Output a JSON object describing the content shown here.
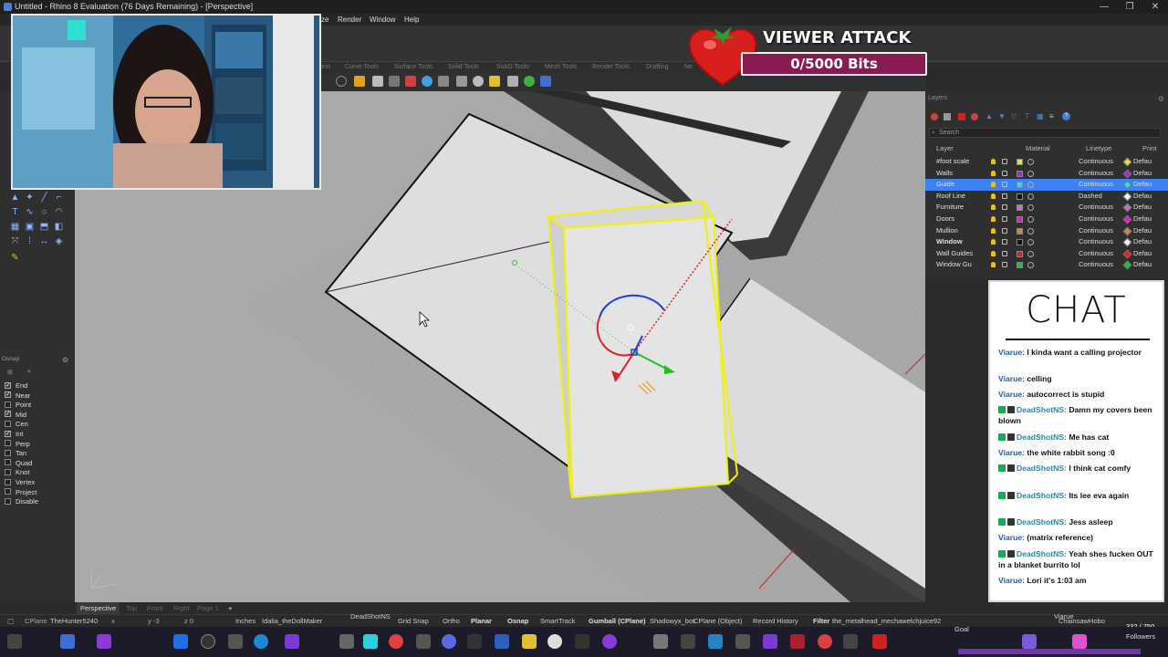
{
  "window": {
    "title": "Untitled - Rhino 8 Evaluation (76 Days Remaining) - [Perspective]",
    "controls": [
      "—",
      "❐",
      "✕"
    ]
  },
  "menu": [
    {
      "label": "ze"
    },
    {
      "label": "Render"
    },
    {
      "label": "Window"
    },
    {
      "label": "Help"
    }
  ],
  "toolbar_tabs": [
    "orm",
    "Curve Tools",
    "Surface Tools",
    "Solid Tools",
    "SubD Tools",
    "Mesh Tools",
    "Render Tools",
    "Drafting",
    "Ne"
  ],
  "osnap": {
    "title": "Osnap",
    "items": [
      {
        "label": "End",
        "checked": true
      },
      {
        "label": "Near",
        "checked": true
      },
      {
        "label": "Point",
        "checked": false
      },
      {
        "label": "Mid",
        "checked": true
      },
      {
        "label": "Cen",
        "checked": false
      },
      {
        "label": "Int",
        "checked": true
      },
      {
        "label": "Perp",
        "checked": false
      },
      {
        "label": "Tan",
        "checked": false
      },
      {
        "label": "Quad",
        "checked": false
      },
      {
        "label": "Knot",
        "checked": false
      },
      {
        "label": "Vertex",
        "checked": false
      },
      {
        "label": "Project",
        "checked": false
      },
      {
        "label": "Disable",
        "checked": false
      }
    ]
  },
  "viewport": {
    "tabs": [
      "Perspective",
      "Top",
      "Front",
      "Right",
      "Page 1",
      "+"
    ],
    "active_tab": "Perspective"
  },
  "layers": {
    "title": "Layers",
    "search_placeholder": "Search",
    "headers": {
      "layer": "Layer",
      "material": "Material",
      "linetype": "Linetype",
      "print": "Print"
    },
    "rows": [
      {
        "name": "#foot scale",
        "color": "#f2e600",
        "linetype": "Continuous",
        "print_color": "#f2e600",
        "print": "Defau",
        "selected": false,
        "bold": false
      },
      {
        "name": "Walls",
        "color": "#a030c0",
        "linetype": "Continuous",
        "print_color": "#a030c0",
        "print": "Defau",
        "selected": false,
        "bold": false
      },
      {
        "name": "Guide",
        "color": "#3ad6e8",
        "linetype": "Continuous",
        "print_color": "#3ad6e8",
        "print": "Defau",
        "selected": true,
        "bold": false
      },
      {
        "name": "Roof Line",
        "color": "#111111",
        "linetype": "Dashed",
        "print_color": "#ffffff",
        "print": "Defau",
        "selected": false,
        "bold": false
      },
      {
        "name": "Furniture",
        "color": "#c070d0",
        "linetype": "Continuous",
        "print_color": "#c070d0",
        "print": "Defau",
        "selected": false,
        "bold": false
      },
      {
        "name": "Doors",
        "color": "#e020c0",
        "linetype": "Continuous",
        "print_color": "#e020c0",
        "print": "Defau",
        "selected": false,
        "bold": false
      },
      {
        "name": "Mullion",
        "color": "#e88020",
        "linetype": "Continuous",
        "print_color": "#e88020",
        "print": "Defau",
        "selected": false,
        "bold": false
      },
      {
        "name": "Window",
        "color": "#111111",
        "linetype": "Continuous",
        "print_color": "#ffffff",
        "print": "Defau",
        "selected": false,
        "bold": true
      },
      {
        "name": "Wall Guides",
        "color": "#e02020",
        "linetype": "Continuous",
        "print_color": "#e02020",
        "print": "Defau",
        "selected": false,
        "bold": false
      },
      {
        "name": "Window Gu",
        "color": "#20c040",
        "linetype": "Continuous",
        "print_color": "#20c040",
        "print": "Defau",
        "selected": false,
        "bold": false
      }
    ]
  },
  "chat": {
    "title": "CHAT",
    "messages": [
      {
        "user": "Viarue:",
        "text": "I kinda want a calling projector",
        "badges": false
      },
      {
        "user": "Viarue:",
        "text": "celling",
        "badges": false
      },
      {
        "user": "Viarue:",
        "text": "autocorrect is stupid",
        "badges": false
      },
      {
        "user": "DeadShotNS:",
        "text": "Damn my covers been blown",
        "badges": true
      },
      {
        "user": "DeadShotNS:",
        "text": "Me has cat",
        "badges": true
      },
      {
        "user": "Viarue:",
        "text": "the white rabbit song :0",
        "badges": false
      },
      {
        "user": "DeadShotNS:",
        "text": "I think cat comfy",
        "badges": true
      },
      {
        "user": "DeadShotNS:",
        "text": "Its lee eva again",
        "badges": true
      },
      {
        "user": "DeadShotNS:",
        "text": "Jess asleep",
        "badges": true
      },
      {
        "user": "Viarue:",
        "text": "(matrix reference)",
        "badges": false
      },
      {
        "user": "DeadShotNS:",
        "text": "Yeah shes fucken OUT in a blanket burrito lol",
        "badges": true
      },
      {
        "user": "Viarue:",
        "text": "Lori it's 1:03 am",
        "badges": false
      }
    ]
  },
  "viewer_attack": {
    "title": "VIEWER ATTACK",
    "progress": "0/5000 Bits"
  },
  "statusbar": {
    "cplane": "CPlane",
    "x": "x",
    "y": "y -3",
    "units": "Inches",
    "layer": "Idalia_theDollMaker",
    "grid_snap": "Grid Snap",
    "ortho": "Ortho",
    "planar": "Planar",
    "osnap": "Osnap",
    "smarttrack": "SmartTrack",
    "gumball": "Gumball (CPlane)",
    "record_history": "Record History",
    "filter": "Filter",
    "overlay_names": [
      "TheHunter5240",
      "DeadShotNS",
      "Shadowyx_bot",
      "the_metalhead_mechawelchjuice92",
      "Viarue",
      "ChainsawHobo",
      "Goal"
    ],
    "followers": "332 / 750",
    "followers_label": "Followers",
    "object_cplane": "CPlane (Object)",
    "coord_z": "z 0"
  },
  "colors": {
    "accent": "#3b82f6",
    "selection": "#f2f200",
    "chat_user": "#1f5fa8"
  }
}
